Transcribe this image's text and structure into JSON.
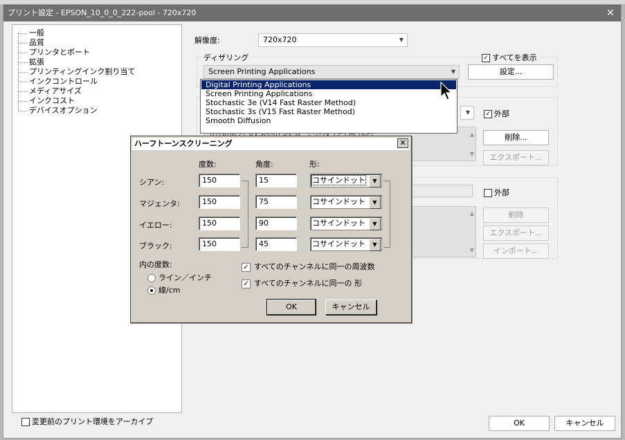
{
  "window": {
    "title": "プリント設定 - EPSON_10_0_0_222-pool - 720x720",
    "close_glyph": "✕"
  },
  "tree": {
    "items": [
      "一般",
      "品質",
      "プリンタとポート",
      "拡張",
      "プリンティングインク割り当て",
      "インクコントロール",
      "メディアサイズ",
      "インクコスト",
      "デバイスオプション"
    ]
  },
  "settings": {
    "resolution_label": "解像度:",
    "resolution_value": "720x720",
    "dithering_label": "ディザリング",
    "show_all_label": "すべてを表示",
    "dithering_value": "Screen Printing Applications",
    "settings_button": "設定...",
    "external_label_1": "外部",
    "delete_button_1": "削除...",
    "export_button_1": "エクスポート...",
    "profile_item": "20160621 PX-6550 PX-H コンクK Lc Lm (6c)",
    "external_label_2": "外部",
    "delete_button_2": "削除",
    "export_button_2": "エクスポート...",
    "import_button_2": "インポート...",
    "section_glyph": "涙"
  },
  "dropdown": {
    "items": [
      "Digital Printing Applications",
      "Screen Printing Applications",
      "Stochastic 3e (V14 Fast Raster Method)",
      "Stochastic 3s (V15 Fast Raster Method)",
      "Smooth Diffusion"
    ],
    "selected_index": 0
  },
  "halftone": {
    "title": "ハーフトーンスクリーニング",
    "close_glyph": "✕",
    "col_frequency": "度数:",
    "col_angle": "角度:",
    "col_shape": "形:",
    "rows": [
      {
        "label": "シアン:",
        "frequency": "150",
        "angle": "15",
        "shape": "コサインドット"
      },
      {
        "label": "マジェンタ:",
        "frequency": "150",
        "angle": "75",
        "shape": "コサインドット"
      },
      {
        "label": "イエロー:",
        "frequency": "150",
        "angle": "90",
        "shape": "コサインドット"
      },
      {
        "label": "ブラック:",
        "frequency": "150",
        "angle": "45",
        "shape": "コサインドット"
      }
    ],
    "frequency_unit_label": "内の度数:",
    "radio_lines_inch": "ライン／インチ",
    "radio_lines_cm": "線/cm",
    "selected_unit": "線/cm",
    "same_frequency_label": "すべてのチャンネルに同一の周波数",
    "same_shape_label": "すべてのチャンネルに同一の 形",
    "ok_button": "OK",
    "cancel_button": "キャンセル"
  },
  "footer": {
    "archive_label": "変更前のプリント環境をアーカイブ",
    "ok_button": "OK",
    "cancel_button": "キャンセル"
  },
  "checkmark_glyph": "✓",
  "arrow_glyph": "▼"
}
